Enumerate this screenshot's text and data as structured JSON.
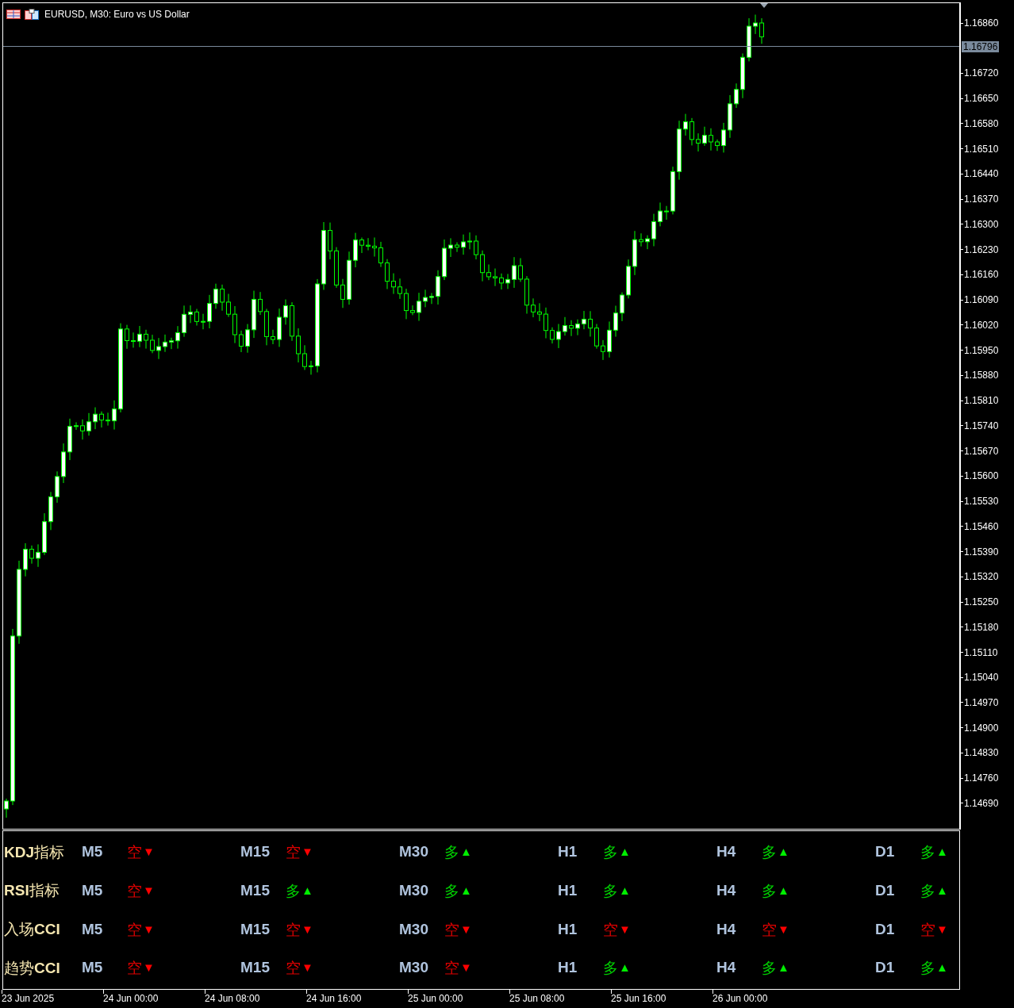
{
  "chart": {
    "title": "EURUSD, M30:  Euro vs US Dollar",
    "current_price": "1.16796",
    "price_ticks": [
      "1.16860",
      "1.16720",
      "1.16650",
      "1.16580",
      "1.16510",
      "1.16440",
      "1.16370",
      "1.16300",
      "1.16230",
      "1.16160",
      "1.16090",
      "1.16020",
      "1.15950",
      "1.15880",
      "1.15810",
      "1.15740",
      "1.15670",
      "1.15600",
      "1.15530",
      "1.15460",
      "1.15390",
      "1.15320",
      "1.15250",
      "1.15180",
      "1.15110",
      "1.15040",
      "1.14970",
      "1.14900",
      "1.14830",
      "1.14760",
      "1.14690"
    ],
    "time_ticks": [
      "23 Jun 2025",
      "24 Jun 00:00",
      "24 Jun 08:00",
      "24 Jun 16:00",
      "25 Jun 00:00",
      "25 Jun 08:00",
      "25 Jun 16:00",
      "26 Jun 00:00"
    ]
  },
  "signals": [
    {
      "label": "**KDJ**指标",
      "cells": [
        {
          "timeframe": "M5",
          "text": "空",
          "arrow": "▼",
          "kind": "down"
        },
        {
          "timeframe": "M15",
          "text": "空",
          "arrow": "▼",
          "kind": "down"
        },
        {
          "timeframe": "M30",
          "text": "多",
          "arrow": "▲",
          "kind": "up"
        },
        {
          "timeframe": "H1",
          "text": "多",
          "arrow": "▲",
          "kind": "up"
        },
        {
          "timeframe": "H4",
          "text": "多",
          "arrow": "▲",
          "kind": "up"
        },
        {
          "timeframe": "D1",
          "text": "多",
          "arrow": "▲",
          "kind": "up"
        }
      ]
    },
    {
      "label": "**RSI**指标",
      "cells": [
        {
          "timeframe": "M5",
          "text": "空",
          "arrow": "▼",
          "kind": "down"
        },
        {
          "timeframe": "M15",
          "text": "多",
          "arrow": "▲",
          "kind": "up"
        },
        {
          "timeframe": "M30",
          "text": "多",
          "arrow": "▲",
          "kind": "up"
        },
        {
          "timeframe": "H1",
          "text": "多",
          "arrow": "▲",
          "kind": "up"
        },
        {
          "timeframe": "H4",
          "text": "多",
          "arrow": "▲",
          "kind": "up"
        },
        {
          "timeframe": "D1",
          "text": "多",
          "arrow": "▲",
          "kind": "up"
        }
      ]
    },
    {
      "label": "入场**CCI**",
      "cells": [
        {
          "timeframe": "M5",
          "text": "空",
          "arrow": "▼",
          "kind": "down"
        },
        {
          "timeframe": "M15",
          "text": "空",
          "arrow": "▼",
          "kind": "down"
        },
        {
          "timeframe": "M30",
          "text": "空",
          "arrow": "▼",
          "kind": "down"
        },
        {
          "timeframe": "H1",
          "text": "空",
          "arrow": "▼",
          "kind": "down"
        },
        {
          "timeframe": "H4",
          "text": "空",
          "arrow": "▼",
          "kind": "down"
        },
        {
          "timeframe": "D1",
          "text": "空",
          "arrow": "▼",
          "kind": "down"
        }
      ]
    },
    {
      "label": "趋势**CCI**",
      "cells": [
        {
          "timeframe": "M5",
          "text": "空",
          "arrow": "▼",
          "kind": "down"
        },
        {
          "timeframe": "M15",
          "text": "空",
          "arrow": "▼",
          "kind": "down"
        },
        {
          "timeframe": "M30",
          "text": "空",
          "arrow": "▼",
          "kind": "down"
        },
        {
          "timeframe": "H1",
          "text": "多",
          "arrow": "▲",
          "kind": "up"
        },
        {
          "timeframe": "H4",
          "text": "多",
          "arrow": "▲",
          "kind": "up"
        },
        {
          "timeframe": "D1",
          "text": "多",
          "arrow": "▲",
          "kind": "up"
        }
      ]
    }
  ]
}
